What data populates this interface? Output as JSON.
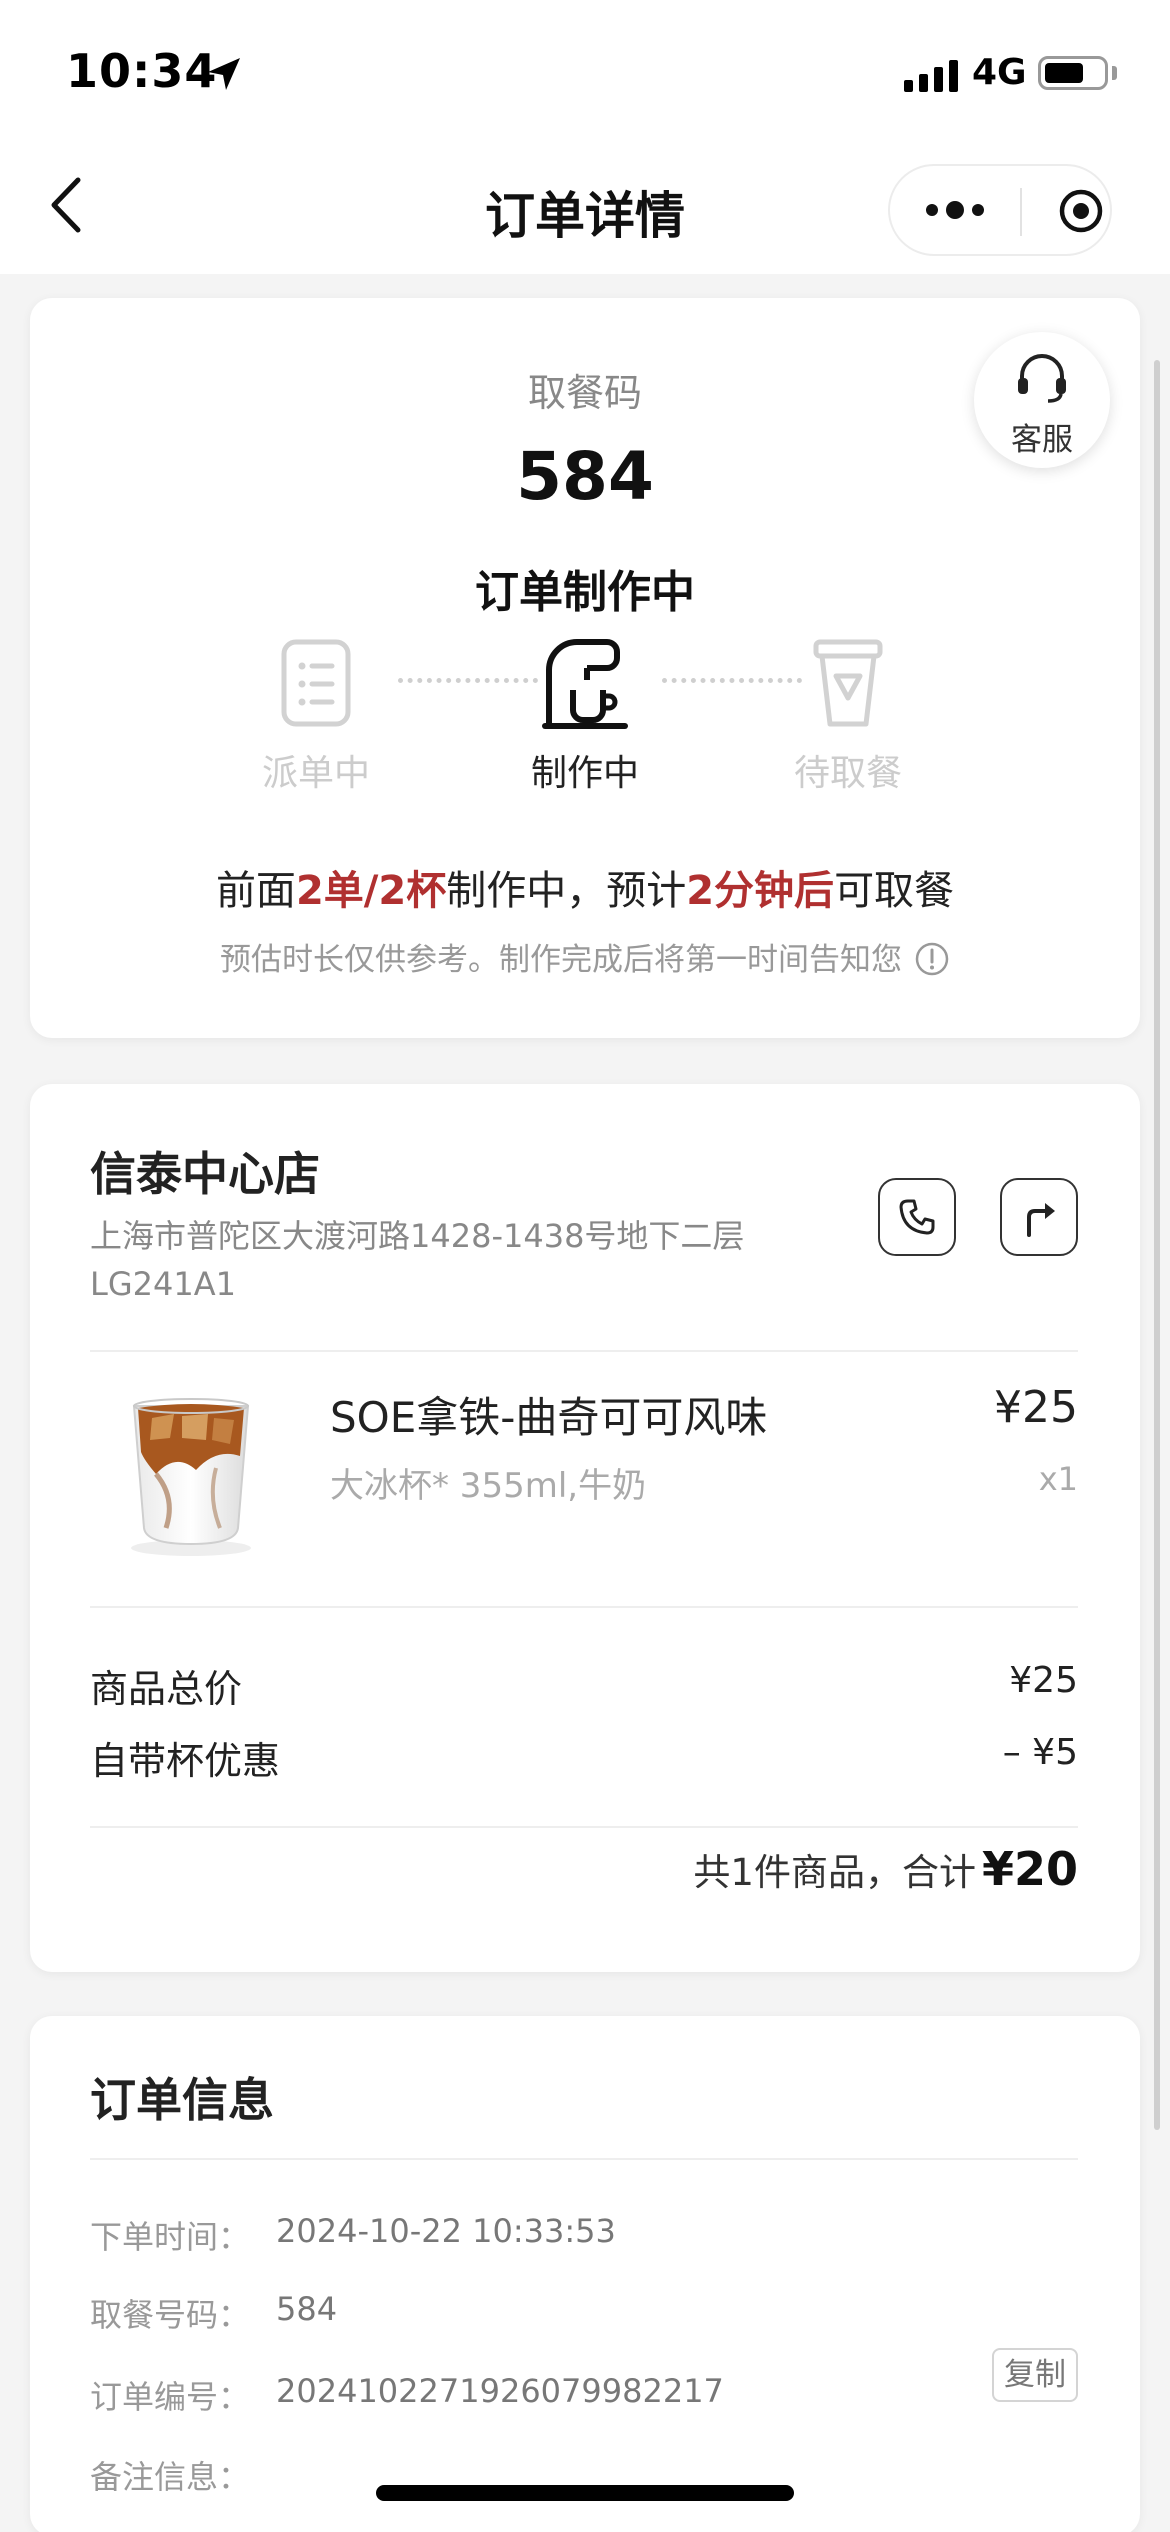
{
  "status_bar": {
    "time": "10:34",
    "network": "4G"
  },
  "nav": {
    "title": "订单详情"
  },
  "pickup": {
    "label": "取餐码",
    "code": "584",
    "status_title": "订单制作中",
    "customer_service": "客服",
    "steps": [
      {
        "label": "派单中",
        "state": "done"
      },
      {
        "label": "制作中",
        "state": "active"
      },
      {
        "label": "待取餐",
        "state": "pending"
      }
    ],
    "queue": {
      "prefix": "前面",
      "orders_cups": "2单/2杯",
      "middle": "制作中，预计",
      "eta": "2分钟后",
      "suffix": "可取餐"
    },
    "note": "预估时长仅供参考。制作完成后将第一时间告知您"
  },
  "store": {
    "name": "信泰中心店",
    "address": "上海市普陀区大渡河路1428-1438号地下二层LG241A1"
  },
  "product": {
    "name": "SOE拿铁-曲奇可可风味",
    "spec": "大冰杯* 355ml,牛奶",
    "price": "¥25",
    "qty": "x1"
  },
  "summary": {
    "subtotal_label": "商品总价",
    "subtotal_value": "¥25",
    "discount_label": "自带杯优惠",
    "discount_value": "– ¥5",
    "total_prefix": "共1件商品，合计",
    "total_value": "¥20"
  },
  "order_info": {
    "title": "订单信息",
    "rows": [
      {
        "label": "下单时间：",
        "value": "2024-10-22 10:33:53"
      },
      {
        "label": "取餐号码：",
        "value": "584"
      },
      {
        "label": "订单编号：",
        "value": "2024102271926079982217"
      },
      {
        "label": "备注信息：",
        "value": ""
      }
    ],
    "copy_label": "复制"
  },
  "colors": {
    "accent_red": "#b03030",
    "background": "#f4f4f4"
  }
}
